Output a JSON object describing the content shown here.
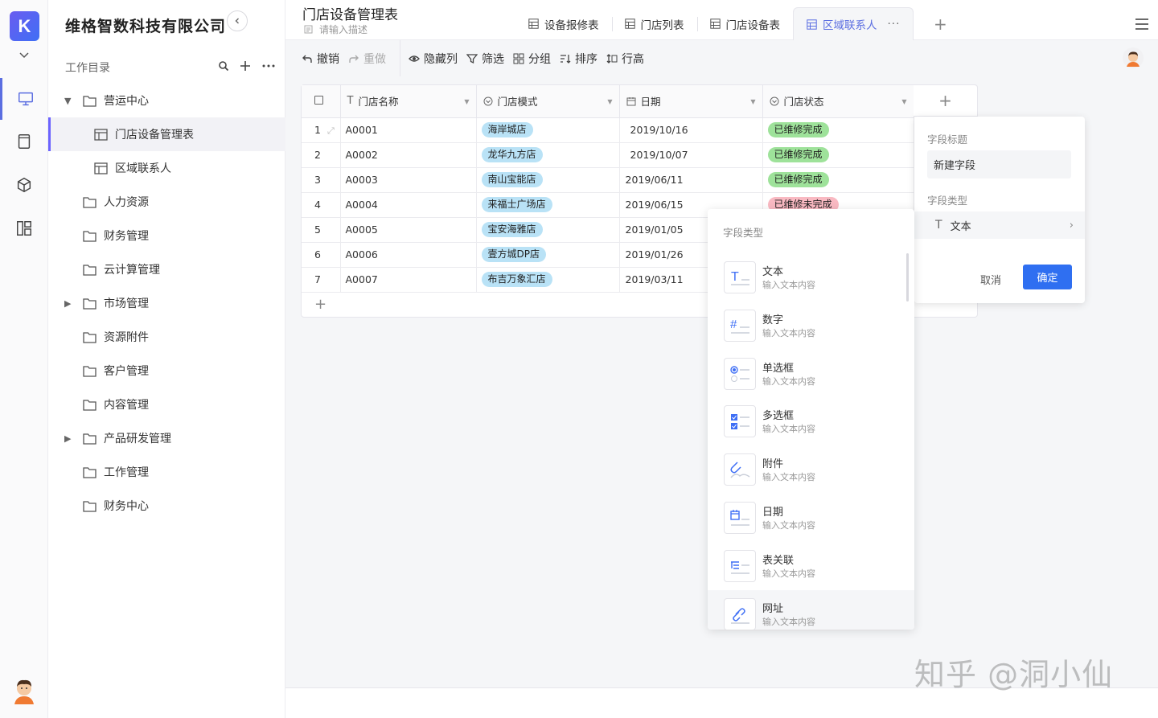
{
  "app": {
    "logo_letter": "K",
    "company": "维格智数科技有限公司"
  },
  "sidebar": {
    "dir_title": "工作目录",
    "items": [
      {
        "label": "营运中心",
        "level": 0,
        "expanded": true,
        "type": "folder"
      },
      {
        "label": "门店设备管理表",
        "level": 1,
        "type": "sheet",
        "selected": true
      },
      {
        "label": "区域联系人",
        "level": 1,
        "type": "sheet"
      },
      {
        "label": "人力资源",
        "level": 0,
        "type": "folder"
      },
      {
        "label": "财务管理",
        "level": 0,
        "type": "folder"
      },
      {
        "label": "云计算管理",
        "level": 0,
        "type": "folder"
      },
      {
        "label": "市场管理",
        "level": 0,
        "type": "folder",
        "collapsed": true
      },
      {
        "label": "资源附件",
        "level": 0,
        "type": "folder"
      },
      {
        "label": "客户管理",
        "level": 0,
        "type": "folder"
      },
      {
        "label": "内容管理",
        "level": 0,
        "type": "folder"
      },
      {
        "label": "产品研发管理",
        "level": 0,
        "type": "folder",
        "collapsed": true
      },
      {
        "label": "工作管理",
        "level": 0,
        "type": "folder"
      },
      {
        "label": "财务中心",
        "level": 0,
        "type": "folder"
      }
    ]
  },
  "header": {
    "title": "门店设备管理表",
    "desc_placeholder": "请输入描述",
    "tabs": [
      "设备报修表",
      "门店列表",
      "门店设备表",
      "区域联系人"
    ],
    "active_tab": "区域联系人"
  },
  "toolbar": {
    "undo": "撤销",
    "redo": "重做",
    "hide_cols": "隐藏列",
    "filter": "筛选",
    "group": "分组",
    "sort": "排序",
    "row_height": "行高"
  },
  "table": {
    "columns": [
      "门店名称",
      "门店模式",
      "日期",
      "门店状态"
    ],
    "rows": [
      {
        "num": "1",
        "name": "A0001",
        "mode": "海岸城店",
        "date": "2019/10/16",
        "status": "已维修完成",
        "status_color": "green"
      },
      {
        "num": "2",
        "name": "A0002",
        "mode": "龙华九方店",
        "date": "2019/10/07",
        "status": "已维修完成",
        "status_color": "green"
      },
      {
        "num": "3",
        "name": "A0003",
        "mode": "南山宝能店",
        "date": "2019/06/11",
        "status": "已维修完成",
        "status_color": "green"
      },
      {
        "num": "4",
        "name": "A0004",
        "mode": "来福士广场店",
        "date": "2019/06/15",
        "status": "已维修未完成",
        "status_color": "red"
      },
      {
        "num": "5",
        "name": "A0005",
        "mode": "宝安海雅店",
        "date": "2019/01/05",
        "status": "",
        "status_color": ""
      },
      {
        "num": "6",
        "name": "A0006",
        "mode": "壹方城DP店",
        "date": "2019/01/26",
        "status": "",
        "status_color": ""
      },
      {
        "num": "7",
        "name": "A0007",
        "mode": "布吉万象汇店",
        "date": "2019/03/11",
        "status": "",
        "status_color": ""
      }
    ]
  },
  "field_panel": {
    "title_label": "字段标题",
    "title_value": "新建字段",
    "type_label": "字段类型",
    "type_value": "文本",
    "cancel": "取消",
    "confirm": "确定"
  },
  "type_menu": {
    "heading": "字段类型",
    "items": [
      {
        "name": "文本",
        "sub": "输入文本内容",
        "icon": "text-type-icon"
      },
      {
        "name": "数字",
        "sub": "输入文本内容",
        "icon": "number-type-icon"
      },
      {
        "name": "单选框",
        "sub": "输入文本内容",
        "icon": "radio-type-icon"
      },
      {
        "name": "多选框",
        "sub": "输入文本内容",
        "icon": "checkbox-type-icon"
      },
      {
        "name": "附件",
        "sub": "输入文本内容",
        "icon": "attachment-type-icon"
      },
      {
        "name": "日期",
        "sub": "输入文本内容",
        "icon": "date-type-icon"
      },
      {
        "name": "表关联",
        "sub": "输入文本内容",
        "icon": "relation-type-icon"
      },
      {
        "name": "网址",
        "sub": "输入文本内容",
        "icon": "url-type-icon"
      }
    ]
  },
  "watermark": "知乎 @洞小仙",
  "colors": {
    "accent": "#5b6ee1",
    "primary_button": "#2f6ff1",
    "pill_blue": "#b9e2f6",
    "pill_green": "#9ee29a",
    "pill_red": "#f9b9c2"
  }
}
